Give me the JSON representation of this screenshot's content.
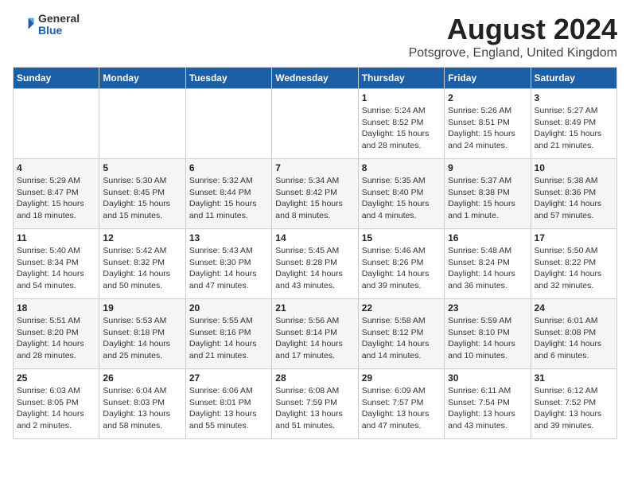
{
  "header": {
    "logo": {
      "general": "General",
      "blue": "Blue"
    },
    "month": "August 2024",
    "location": "Potsgrove, England, United Kingdom"
  },
  "days_of_week": [
    "Sunday",
    "Monday",
    "Tuesday",
    "Wednesday",
    "Thursday",
    "Friday",
    "Saturday"
  ],
  "weeks": [
    [
      {
        "day": "",
        "info": ""
      },
      {
        "day": "",
        "info": ""
      },
      {
        "day": "",
        "info": ""
      },
      {
        "day": "",
        "info": ""
      },
      {
        "day": "1",
        "info": "Sunrise: 5:24 AM\nSunset: 8:52 PM\nDaylight: 15 hours\nand 28 minutes."
      },
      {
        "day": "2",
        "info": "Sunrise: 5:26 AM\nSunset: 8:51 PM\nDaylight: 15 hours\nand 24 minutes."
      },
      {
        "day": "3",
        "info": "Sunrise: 5:27 AM\nSunset: 8:49 PM\nDaylight: 15 hours\nand 21 minutes."
      }
    ],
    [
      {
        "day": "4",
        "info": "Sunrise: 5:29 AM\nSunset: 8:47 PM\nDaylight: 15 hours\nand 18 minutes."
      },
      {
        "day": "5",
        "info": "Sunrise: 5:30 AM\nSunset: 8:45 PM\nDaylight: 15 hours\nand 15 minutes."
      },
      {
        "day": "6",
        "info": "Sunrise: 5:32 AM\nSunset: 8:44 PM\nDaylight: 15 hours\nand 11 minutes."
      },
      {
        "day": "7",
        "info": "Sunrise: 5:34 AM\nSunset: 8:42 PM\nDaylight: 15 hours\nand 8 minutes."
      },
      {
        "day": "8",
        "info": "Sunrise: 5:35 AM\nSunset: 8:40 PM\nDaylight: 15 hours\nand 4 minutes."
      },
      {
        "day": "9",
        "info": "Sunrise: 5:37 AM\nSunset: 8:38 PM\nDaylight: 15 hours\nand 1 minute."
      },
      {
        "day": "10",
        "info": "Sunrise: 5:38 AM\nSunset: 8:36 PM\nDaylight: 14 hours\nand 57 minutes."
      }
    ],
    [
      {
        "day": "11",
        "info": "Sunrise: 5:40 AM\nSunset: 8:34 PM\nDaylight: 14 hours\nand 54 minutes."
      },
      {
        "day": "12",
        "info": "Sunrise: 5:42 AM\nSunset: 8:32 PM\nDaylight: 14 hours\nand 50 minutes."
      },
      {
        "day": "13",
        "info": "Sunrise: 5:43 AM\nSunset: 8:30 PM\nDaylight: 14 hours\nand 47 minutes."
      },
      {
        "day": "14",
        "info": "Sunrise: 5:45 AM\nSunset: 8:28 PM\nDaylight: 14 hours\nand 43 minutes."
      },
      {
        "day": "15",
        "info": "Sunrise: 5:46 AM\nSunset: 8:26 PM\nDaylight: 14 hours\nand 39 minutes."
      },
      {
        "day": "16",
        "info": "Sunrise: 5:48 AM\nSunset: 8:24 PM\nDaylight: 14 hours\nand 36 minutes."
      },
      {
        "day": "17",
        "info": "Sunrise: 5:50 AM\nSunset: 8:22 PM\nDaylight: 14 hours\nand 32 minutes."
      }
    ],
    [
      {
        "day": "18",
        "info": "Sunrise: 5:51 AM\nSunset: 8:20 PM\nDaylight: 14 hours\nand 28 minutes."
      },
      {
        "day": "19",
        "info": "Sunrise: 5:53 AM\nSunset: 8:18 PM\nDaylight: 14 hours\nand 25 minutes."
      },
      {
        "day": "20",
        "info": "Sunrise: 5:55 AM\nSunset: 8:16 PM\nDaylight: 14 hours\nand 21 minutes."
      },
      {
        "day": "21",
        "info": "Sunrise: 5:56 AM\nSunset: 8:14 PM\nDaylight: 14 hours\nand 17 minutes."
      },
      {
        "day": "22",
        "info": "Sunrise: 5:58 AM\nSunset: 8:12 PM\nDaylight: 14 hours\nand 14 minutes."
      },
      {
        "day": "23",
        "info": "Sunrise: 5:59 AM\nSunset: 8:10 PM\nDaylight: 14 hours\nand 10 minutes."
      },
      {
        "day": "24",
        "info": "Sunrise: 6:01 AM\nSunset: 8:08 PM\nDaylight: 14 hours\nand 6 minutes."
      }
    ],
    [
      {
        "day": "25",
        "info": "Sunrise: 6:03 AM\nSunset: 8:05 PM\nDaylight: 14 hours\nand 2 minutes."
      },
      {
        "day": "26",
        "info": "Sunrise: 6:04 AM\nSunset: 8:03 PM\nDaylight: 13 hours\nand 58 minutes."
      },
      {
        "day": "27",
        "info": "Sunrise: 6:06 AM\nSunset: 8:01 PM\nDaylight: 13 hours\nand 55 minutes."
      },
      {
        "day": "28",
        "info": "Sunrise: 6:08 AM\nSunset: 7:59 PM\nDaylight: 13 hours\nand 51 minutes."
      },
      {
        "day": "29",
        "info": "Sunrise: 6:09 AM\nSunset: 7:57 PM\nDaylight: 13 hours\nand 47 minutes."
      },
      {
        "day": "30",
        "info": "Sunrise: 6:11 AM\nSunset: 7:54 PM\nDaylight: 13 hours\nand 43 minutes."
      },
      {
        "day": "31",
        "info": "Sunrise: 6:12 AM\nSunset: 7:52 PM\nDaylight: 13 hours\nand 39 minutes."
      }
    ]
  ]
}
